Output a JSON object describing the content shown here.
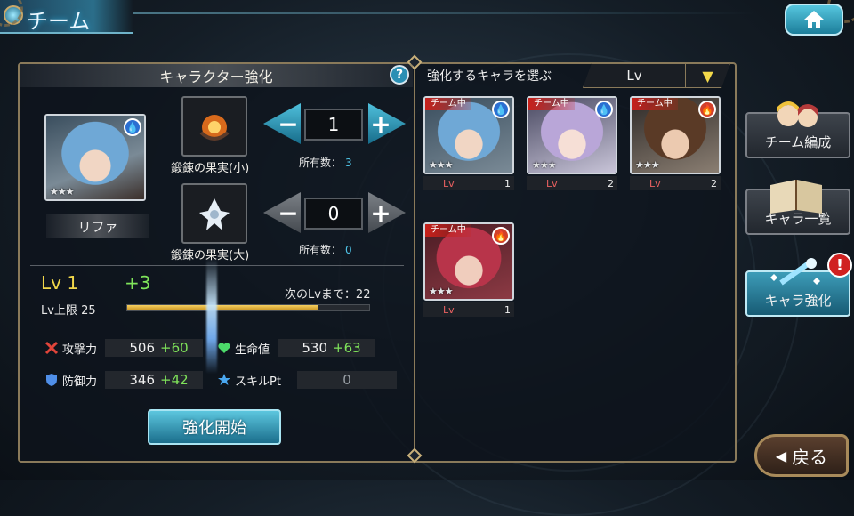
{
  "header": {
    "title": "チーム"
  },
  "left_panel": {
    "title": "キャラクター強化",
    "help_label": "?",
    "character": {
      "name": "リファ",
      "element": "water",
      "stars": "★★★"
    },
    "items": [
      {
        "name": "鍛錬の果実(小)",
        "quantity": "1",
        "owned_label": "所有数：",
        "owned_value": "3"
      },
      {
        "name": "鍛錬の果実(大)",
        "quantity": "0",
        "owned_label": "所有数：",
        "owned_value": "0"
      }
    ],
    "level": "Lv 1",
    "level_gain": "+3",
    "level_cap": "Lv上限 25",
    "next_level_label": "次のLvまで：22",
    "exp_progress": 0.79,
    "stats": [
      {
        "label": "攻撃力",
        "base": "506",
        "bonus": "+60",
        "icon": "sword-icon"
      },
      {
        "label": "生命値",
        "base": "530",
        "bonus": "+63",
        "icon": "heart-icon"
      },
      {
        "label": "防御力",
        "base": "346",
        "bonus": "+42",
        "icon": "shield-icon"
      },
      {
        "label": "スキルPt",
        "base": "0",
        "bonus": "",
        "icon": "star-icon"
      }
    ],
    "enhance_button": "強化開始"
  },
  "right_panel": {
    "title": "強化するキャラを選ぶ",
    "sort_label": "Lv",
    "sort_arrow": "▼",
    "cards": [
      {
        "tag": "チーム中",
        "element": "water",
        "stars": "★★★",
        "lv_label": "Lv",
        "level": "1"
      },
      {
        "tag": "チーム中",
        "element": "water",
        "stars": "★★★",
        "lv_label": "Lv",
        "level": "2"
      },
      {
        "tag": "チーム中",
        "element": "fire",
        "stars": "★★★",
        "lv_label": "Lv",
        "level": "2"
      },
      {
        "tag": "チーム中",
        "element": "fire",
        "stars": "★★★",
        "lv_label": "Lv",
        "level": "1"
      }
    ]
  },
  "side_menu": [
    {
      "label": "チーム編成",
      "active": false
    },
    {
      "label": "キャラ一覧",
      "active": false
    },
    {
      "label": "キャラ強化",
      "active": true
    }
  ],
  "alert_badge": "!",
  "back_button": {
    "arrow": "◀",
    "label": "戻る"
  },
  "colors": {
    "accent": "#2a8fb4",
    "level": "#f0d64a",
    "bonus": "#7fe35a",
    "owned": "#4fc3e6",
    "team_tag": "#c8201a"
  }
}
